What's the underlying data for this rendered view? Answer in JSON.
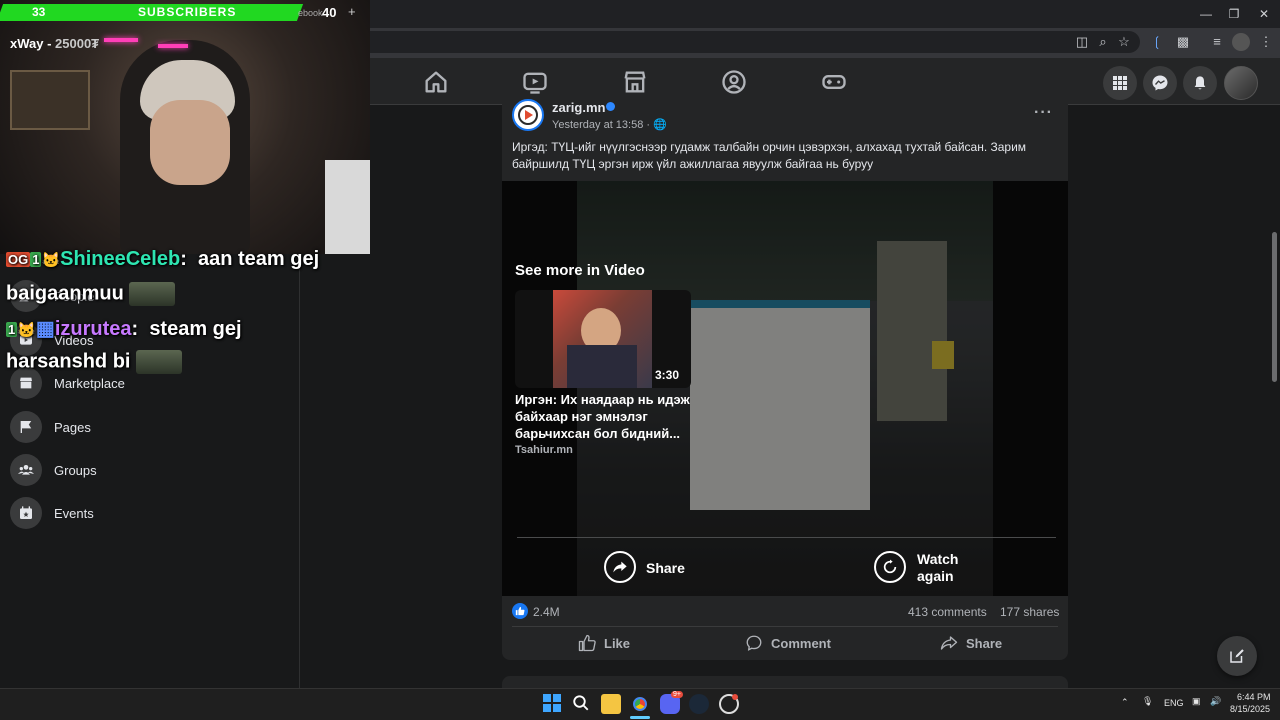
{
  "overlay": {
    "subscriber_count": "33",
    "subscriber_label": "SUBSCRIBERS",
    "subscriber_goal": "40",
    "goal_tab_fragment": "ebook",
    "donor_name": "xWay - ",
    "donor_amount": "25000₮",
    "chat": [
      {
        "badges": "OG 1st",
        "user": "ShineeCeleb",
        "sep": ":",
        "message": "aan team gej",
        "message2": "baigaanmuu"
      },
      {
        "badges": "1st",
        "user": "izurutea",
        "sep": ":",
        "message": "steam gej",
        "message2": "harsanshd bi"
      }
    ]
  },
  "sidebar": {
    "items": [
      {
        "label": "People",
        "icon": "people-icon"
      },
      {
        "label": "Videos",
        "icon": "video-icon"
      },
      {
        "label": "Marketplace",
        "icon": "marketplace-icon"
      },
      {
        "label": "Pages",
        "icon": "flag-icon"
      },
      {
        "label": "Groups",
        "icon": "groups-icon"
      },
      {
        "label": "Events",
        "icon": "calendar-icon"
      }
    ]
  },
  "post": {
    "page_name": "zarig.mn",
    "time": "Yesterday at 13:58 ·",
    "text": "Иргэд: ТҮЦ-ийг нүүлгэснээр гудамж талбайн орчин цэвэрхэн, алхахад тухтай  байсан. Зарим байршилд ТҮЦ эргэн ирж үйл ажиллагаа явуулж байгаа нь буруу",
    "video_overlay": {
      "see_more": "See more in Video",
      "related_duration": "3:30",
      "related_title": "Иргэн: Их наядаар нь идэж байхаар нэг эмнэлэг барьчихсан бол бидний...",
      "related_source": "Tsahiur.mn",
      "share_label": "Share",
      "watch_again_label": "Watch again"
    },
    "reactions": "2.4M",
    "comments": "413 comments",
    "shares": "177 shares",
    "actions": {
      "like": "Like",
      "comment": "Comment",
      "share": "Share"
    }
  },
  "taskbar": {
    "language": "ENG",
    "time": "6:44 PM",
    "date": "8/15/2025",
    "discord_badge": "9+"
  },
  "colors": {
    "facebook_blue": "#1877f2",
    "subscriber_bar": "#21d821",
    "background": "#18191a"
  }
}
